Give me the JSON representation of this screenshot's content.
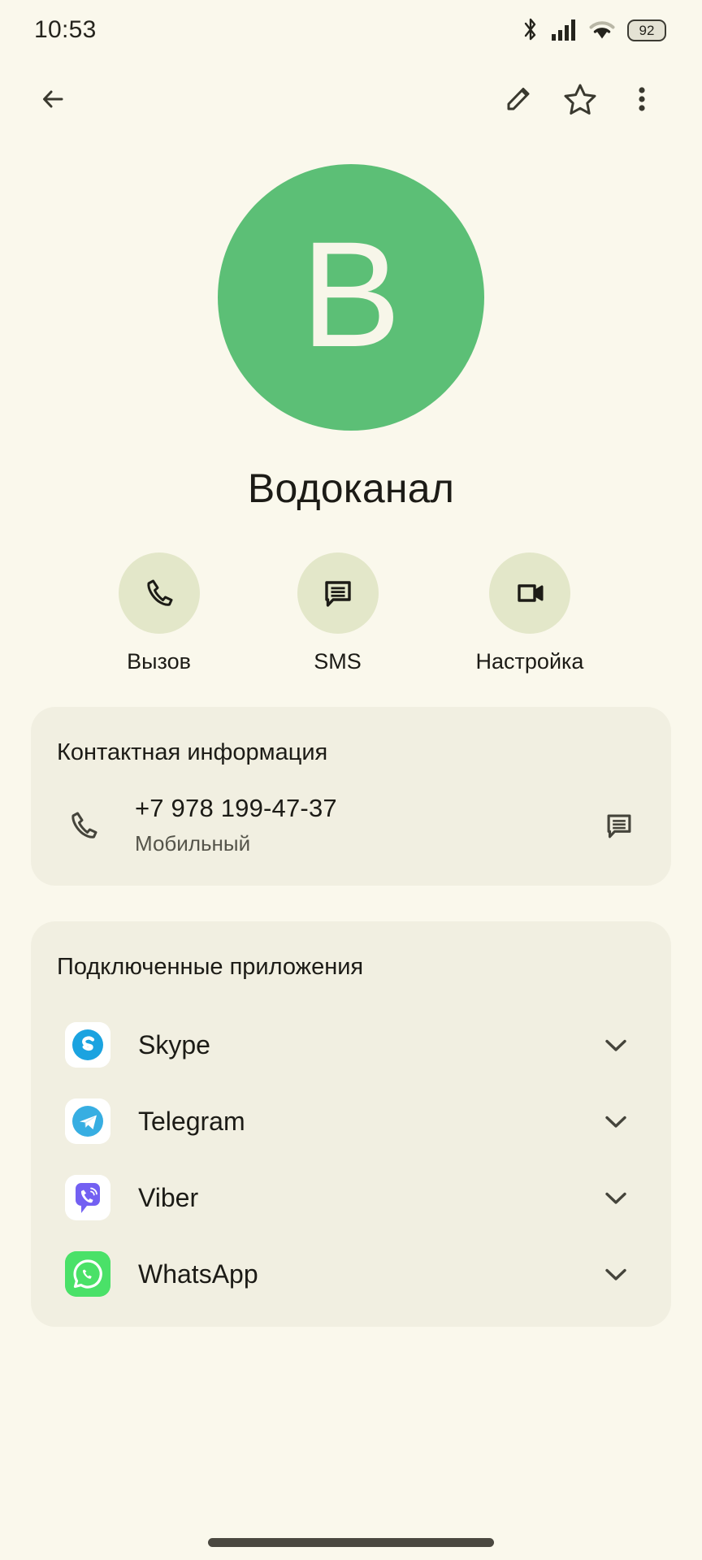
{
  "status_bar": {
    "time": "10:53",
    "battery_percent": "92",
    "icons": [
      "bluetooth-icon",
      "cellular-signal-icon",
      "wifi-icon",
      "battery-icon"
    ]
  },
  "app_bar": {
    "back": "back-arrow-icon",
    "edit": "pencil-icon",
    "favorite": "star-outline-icon",
    "overflow": "more-vertical-icon"
  },
  "contact": {
    "avatar_letter": "В",
    "avatar_color": "#5CBF76",
    "name": "Водоканал"
  },
  "quick_actions": [
    {
      "label": "Вызов",
      "icon": "phone-icon"
    },
    {
      "label": "SMS",
      "icon": "message-icon"
    },
    {
      "label": "Настройка",
      "icon": "video-camera-icon"
    }
  ],
  "contact_info": {
    "title": "Контактная информация",
    "phone": {
      "number": "+7 978 199-47-37",
      "type": "Мобильный",
      "lead_icon": "phone-icon",
      "trailing_icon": "message-icon"
    }
  },
  "connected_apps": {
    "title": "Подключенные приложения",
    "items": [
      {
        "name": "Skype",
        "icon": "skype-icon",
        "chevron": "chevron-down-icon"
      },
      {
        "name": "Telegram",
        "icon": "telegram-icon",
        "chevron": "chevron-down-icon"
      },
      {
        "name": "Viber",
        "icon": "viber-icon",
        "chevron": "chevron-down-icon"
      },
      {
        "name": "WhatsApp",
        "icon": "whatsapp-icon",
        "chevron": "chevron-down-icon"
      }
    ]
  },
  "theme": {
    "page_background": "#FAF8EC",
    "card_background": "#F1EFE1",
    "accent_chip": "#E3E7C9",
    "text_primary": "#1C1B16",
    "text_secondary": "#55544A"
  }
}
